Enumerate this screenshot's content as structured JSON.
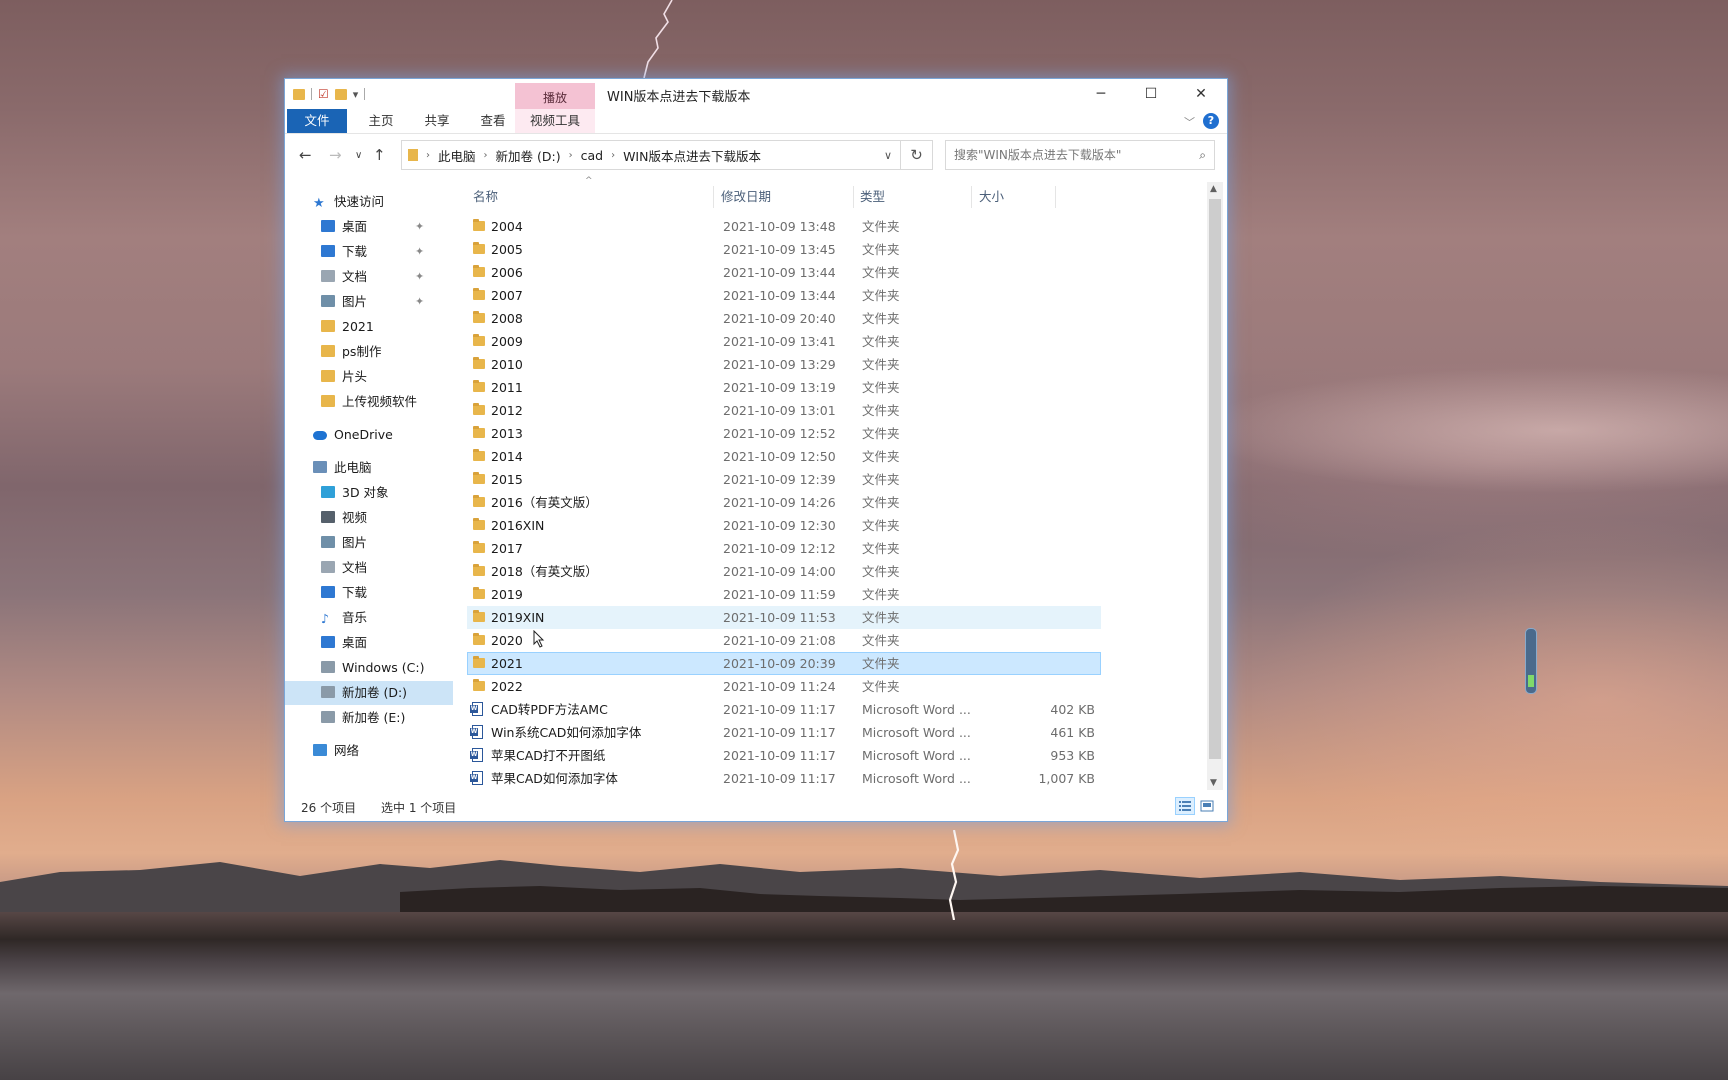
{
  "window": {
    "title": "WIN版本点进去下载版本",
    "context_tab": "播放",
    "controls": {
      "minimize": "─",
      "maximize": "☐",
      "close": "✕"
    }
  },
  "ribbon": {
    "tabs": [
      "文件",
      "主页",
      "共享",
      "查看",
      "视频工具"
    ],
    "help_label": "?"
  },
  "address": {
    "crumbs": [
      "此电脑",
      "新加卷 (D:)",
      "cad",
      "WIN版本点进去下载版本"
    ],
    "search_placeholder": "搜索\"WIN版本点进去下载版本\""
  },
  "sidebar": {
    "quick_access": "快速访问",
    "quick_items": [
      {
        "label": "桌面",
        "icon": "desktop-icon",
        "pinned": true
      },
      {
        "label": "下载",
        "icon": "download-icon",
        "pinned": true
      },
      {
        "label": "文档",
        "icon": "documents-icon",
        "pinned": true
      },
      {
        "label": "图片",
        "icon": "pictures-icon",
        "pinned": true
      },
      {
        "label": "2021",
        "icon": "folder-icon",
        "pinned": false
      },
      {
        "label": "ps制作",
        "icon": "folder-icon",
        "pinned": false
      },
      {
        "label": "片头",
        "icon": "folder-icon",
        "pinned": false
      },
      {
        "label": "上传视频软件",
        "icon": "folder-icon",
        "pinned": false
      }
    ],
    "onedrive": "OneDrive",
    "this_pc": "此电脑",
    "pc_items": [
      {
        "label": "3D 对象",
        "icon": "3d-objects-icon"
      },
      {
        "label": "视频",
        "icon": "videos-icon"
      },
      {
        "label": "图片",
        "icon": "pictures-icon"
      },
      {
        "label": "文档",
        "icon": "documents-icon"
      },
      {
        "label": "下载",
        "icon": "download-icon"
      },
      {
        "label": "音乐",
        "icon": "music-icon"
      },
      {
        "label": "桌面",
        "icon": "desktop-icon"
      },
      {
        "label": "Windows (C:)",
        "icon": "drive-icon"
      },
      {
        "label": "新加卷 (D:)",
        "icon": "drive-icon"
      },
      {
        "label": "新加卷 (E:)",
        "icon": "drive-icon"
      }
    ],
    "network": "网络"
  },
  "list": {
    "columns": [
      "名称",
      "修改日期",
      "类型",
      "大小"
    ],
    "rows": [
      {
        "name": "2004",
        "date": "2021-10-09 13:48",
        "type": "文件夹",
        "size": "",
        "kind": "folder"
      },
      {
        "name": "2005",
        "date": "2021-10-09 13:45",
        "type": "文件夹",
        "size": "",
        "kind": "folder"
      },
      {
        "name": "2006",
        "date": "2021-10-09 13:44",
        "type": "文件夹",
        "size": "",
        "kind": "folder"
      },
      {
        "name": "2007",
        "date": "2021-10-09 13:44",
        "type": "文件夹",
        "size": "",
        "kind": "folder"
      },
      {
        "name": "2008",
        "date": "2021-10-09 20:40",
        "type": "文件夹",
        "size": "",
        "kind": "folder"
      },
      {
        "name": "2009",
        "date": "2021-10-09 13:41",
        "type": "文件夹",
        "size": "",
        "kind": "folder"
      },
      {
        "name": "2010",
        "date": "2021-10-09 13:29",
        "type": "文件夹",
        "size": "",
        "kind": "folder"
      },
      {
        "name": "2011",
        "date": "2021-10-09 13:19",
        "type": "文件夹",
        "size": "",
        "kind": "folder"
      },
      {
        "name": "2012",
        "date": "2021-10-09 13:01",
        "type": "文件夹",
        "size": "",
        "kind": "folder"
      },
      {
        "name": "2013",
        "date": "2021-10-09 12:52",
        "type": "文件夹",
        "size": "",
        "kind": "folder"
      },
      {
        "name": "2014",
        "date": "2021-10-09 12:50",
        "type": "文件夹",
        "size": "",
        "kind": "folder"
      },
      {
        "name": "2015",
        "date": "2021-10-09 12:39",
        "type": "文件夹",
        "size": "",
        "kind": "folder"
      },
      {
        "name": "2016（有英文版）",
        "date": "2021-10-09 14:26",
        "type": "文件夹",
        "size": "",
        "kind": "folder"
      },
      {
        "name": "2016XIN",
        "date": "2021-10-09 12:30",
        "type": "文件夹",
        "size": "",
        "kind": "folder"
      },
      {
        "name": "2017",
        "date": "2021-10-09 12:12",
        "type": "文件夹",
        "size": "",
        "kind": "folder"
      },
      {
        "name": "2018（有英文版）",
        "date": "2021-10-09 14:00",
        "type": "文件夹",
        "size": "",
        "kind": "folder"
      },
      {
        "name": "2019",
        "date": "2021-10-09 11:59",
        "type": "文件夹",
        "size": "",
        "kind": "folder"
      },
      {
        "name": "2019XIN",
        "date": "2021-10-09 11:53",
        "type": "文件夹",
        "size": "",
        "kind": "folder",
        "state": "hover"
      },
      {
        "name": "2020",
        "date": "2021-10-09 21:08",
        "type": "文件夹",
        "size": "",
        "kind": "folder"
      },
      {
        "name": "2021",
        "date": "2021-10-09 20:39",
        "type": "文件夹",
        "size": "",
        "kind": "folder",
        "state": "selected"
      },
      {
        "name": "2022",
        "date": "2021-10-09 11:24",
        "type": "文件夹",
        "size": "",
        "kind": "folder"
      },
      {
        "name": "CAD转PDF方法AMC",
        "date": "2021-10-09 11:17",
        "type": "Microsoft Word ...",
        "size": "402 KB",
        "kind": "doc"
      },
      {
        "name": "Win系统CAD如何添加字体",
        "date": "2021-10-09 11:17",
        "type": "Microsoft Word ...",
        "size": "461 KB",
        "kind": "doc"
      },
      {
        "name": "苹果CAD打不开图纸",
        "date": "2021-10-09 11:17",
        "type": "Microsoft Word ...",
        "size": "953 KB",
        "kind": "doc"
      },
      {
        "name": "苹果CAD如何添加字体",
        "date": "2021-10-09 11:17",
        "type": "Microsoft Word ...",
        "size": "1,007 KB",
        "kind": "doc"
      }
    ]
  },
  "status": {
    "count": "26 个项目",
    "selected": "选中 1 个项目"
  },
  "colors": {
    "accent": "#1a64b5",
    "selection": "#cce8ff",
    "folder": "#e8b64b"
  }
}
